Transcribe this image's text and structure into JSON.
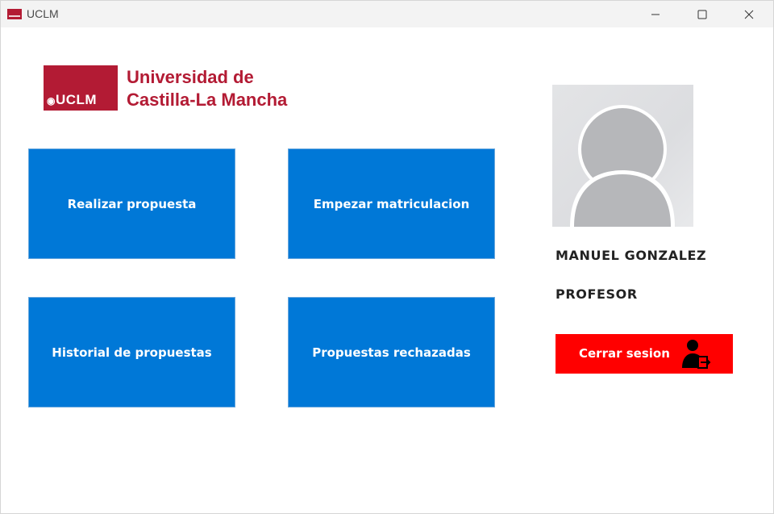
{
  "window": {
    "title": "UCLM",
    "controls": [
      "minimize",
      "maximize",
      "close"
    ]
  },
  "logo": {
    "badge_text": "UCLM",
    "line1": "Universidad de",
    "line2": "Castilla-La Mancha",
    "brand_color": "#b31b34"
  },
  "actions": {
    "realizar_propuesta": "Realizar propuesta",
    "empezar_matriculacion": "Empezar matriculacion",
    "historial_propuestas": "Historial de propuestas",
    "propuestas_rechazadas": "Propuestas rechazadas",
    "tile_color": "#0078d7"
  },
  "user": {
    "name": "MANUEL GONZALEZ",
    "role": "PROFESOR",
    "avatar_icon": "default-user-avatar"
  },
  "logout": {
    "label": "Cerrar sesion",
    "icon": "user-logout-icon",
    "color": "#ff0000"
  }
}
